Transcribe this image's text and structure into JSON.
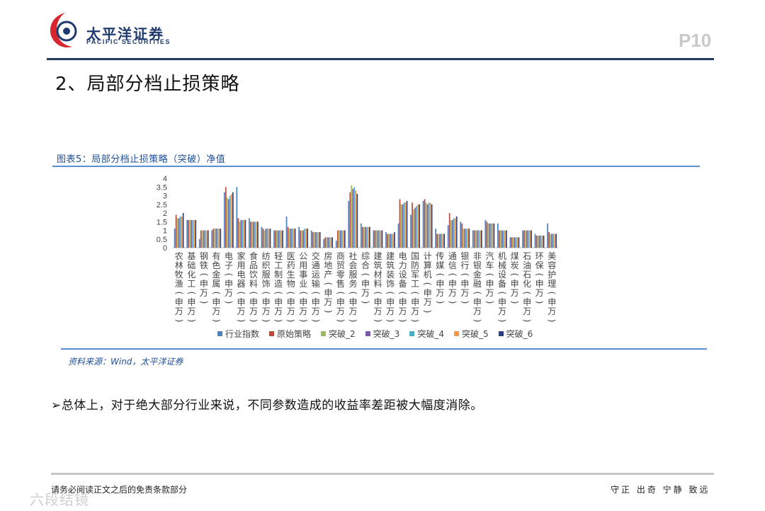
{
  "header": {
    "logo_cn": "太平洋证券",
    "logo_en": "PACIFIC SECURITIES",
    "page_number": "P10"
  },
  "section": {
    "title": "2、局部分档止损策略"
  },
  "chart": {
    "caption": "图表5：局部分档止损策略（突破）净值",
    "source": "资料来源：Wind，太平洋证券"
  },
  "colors": {
    "series": [
      "#4a7fc1",
      "#b94a3e",
      "#9bbb59",
      "#7a5aa8",
      "#4bacc6",
      "#f79646",
      "#2b3f7a"
    ]
  },
  "chart_data": {
    "type": "bar",
    "ylim": [
      0,
      4
    ],
    "yticks": [
      "0",
      "0.5",
      "1",
      "1.5",
      "2",
      "2.5",
      "3",
      "3.5",
      "4"
    ],
    "categories": [
      "农林牧渔(申万)",
      "基础化工(申万)",
      "钢铁(申万)",
      "有色金属(申万)",
      "电子(申万)",
      "家用电器(申万)",
      "食品饮料(申万)",
      "纺织服饰(申万)",
      "轻工制造(申万)",
      "医药生物(申万)",
      "公用事业(申万)",
      "交通运输(申万)",
      "房地产(申万)",
      "商贸零售(申万)",
      "社会服务(申万)",
      "综合(申万)",
      "建筑材料(申万)",
      "建筑装饰(申万)",
      "电力设备(申万)",
      "国防军工(申万)",
      "计算机(申万)",
      "传媒(申万)",
      "通信(申万)",
      "银行(申万)",
      "非银金融(申万)",
      "汽车(申万)",
      "机械设备(申万)",
      "煤炭(申万)",
      "石油石化(申万)",
      "环保(申万)",
      "美容护理(申万)"
    ],
    "series": [
      {
        "name": "行业指数",
        "values": [
          1.1,
          1.6,
          0.5,
          1.0,
          3.2,
          3.5,
          1.7,
          1.2,
          1.0,
          1.8,
          1.2,
          1.0,
          0.5,
          0.4,
          2.7,
          1.4,
          1.0,
          0.9,
          1.4,
          1.9,
          2.7,
          1.1,
          1.3,
          1.5,
          1.0,
          1.6,
          1.4,
          0.6,
          1.0,
          0.8,
          1.4
        ]
      },
      {
        "name": "原始策略",
        "values": [
          1.9,
          1.6,
          1.0,
          1.1,
          3.5,
          1.7,
          1.5,
          1.1,
          1.0,
          1.2,
          1.0,
          0.9,
          0.6,
          1.0,
          3.2,
          1.2,
          1.0,
          0.8,
          2.8,
          2.6,
          2.8,
          0.8,
          2.0,
          1.4,
          1.0,
          1.5,
          1.0,
          0.6,
          1.0,
          0.7,
          0.9
        ]
      },
      {
        "name": "突破_2",
        "values": [
          1.7,
          1.6,
          1.0,
          1.1,
          2.9,
          1.5,
          1.5,
          1.0,
          1.0,
          1.1,
          1.0,
          0.9,
          0.6,
          1.0,
          3.6,
          1.2,
          1.0,
          0.8,
          2.5,
          2.2,
          2.6,
          0.8,
          1.6,
          1.1,
          1.0,
          1.4,
          1.0,
          0.6,
          1.0,
          0.7,
          0.8
        ]
      },
      {
        "name": "突破_3",
        "values": [
          1.7,
          1.6,
          1.0,
          1.1,
          2.8,
          1.6,
          1.5,
          1.1,
          1.0,
          1.1,
          1.0,
          0.9,
          0.6,
          1.0,
          3.4,
          1.2,
          1.0,
          0.8,
          2.5,
          2.3,
          2.5,
          0.8,
          1.6,
          1.1,
          1.0,
          1.4,
          1.0,
          0.6,
          1.0,
          0.7,
          0.8
        ]
      },
      {
        "name": "突破_4",
        "values": [
          1.8,
          1.6,
          1.0,
          1.1,
          3.0,
          1.6,
          1.5,
          1.1,
          1.0,
          1.1,
          1.1,
          0.9,
          0.6,
          1.0,
          3.5,
          1.2,
          1.0,
          0.8,
          2.6,
          2.4,
          2.6,
          0.8,
          1.7,
          1.1,
          1.0,
          1.4,
          1.0,
          0.6,
          1.0,
          0.7,
          0.8
        ]
      },
      {
        "name": "突破_5",
        "values": [
          1.8,
          1.6,
          1.0,
          1.1,
          3.1,
          1.6,
          1.5,
          1.1,
          1.0,
          1.1,
          1.1,
          0.9,
          0.6,
          1.0,
          3.3,
          1.2,
          1.0,
          0.8,
          2.6,
          2.5,
          2.6,
          0.8,
          1.7,
          1.1,
          1.0,
          1.4,
          1.0,
          0.6,
          1.0,
          0.7,
          0.8
        ]
      },
      {
        "name": "突破_6",
        "values": [
          2.0,
          1.6,
          1.0,
          1.1,
          3.2,
          1.6,
          1.5,
          1.1,
          1.0,
          1.1,
          1.1,
          0.9,
          0.6,
          1.0,
          3.1,
          1.2,
          1.0,
          0.9,
          2.7,
          2.5,
          2.5,
          0.8,
          1.8,
          1.1,
          1.0,
          1.4,
          1.0,
          0.6,
          1.0,
          0.7,
          0.8
        ]
      }
    ]
  },
  "body": {
    "bullet": "➢",
    "text": "总体上，对于绝大部分行业来说，不同参数造成的收益率差距被大幅度消除。"
  },
  "footer": {
    "left": "请务必阅读正文之后的免责条款部分",
    "right": "守正 出奇 宁静 致远",
    "watermark": "六段结镜"
  }
}
